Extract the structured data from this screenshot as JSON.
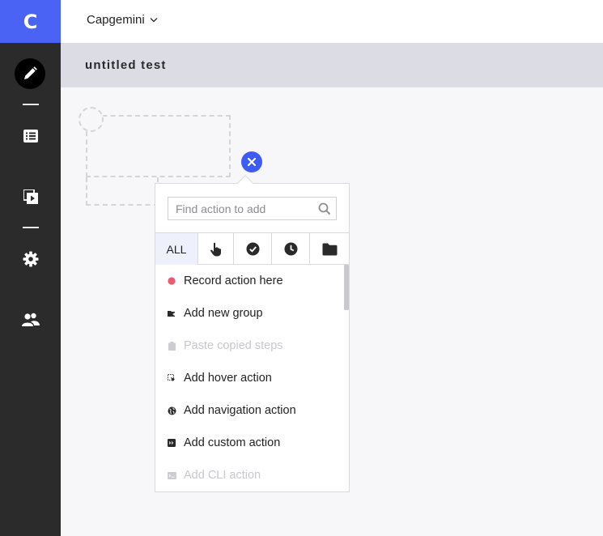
{
  "app": {
    "logo_letter": "C",
    "accent": "#4a63f5"
  },
  "sidebar": {
    "items": [
      {
        "name": "edit",
        "icon": "pencil-icon",
        "active": true
      },
      {
        "name": "tests",
        "icon": "list-icon"
      },
      {
        "name": "runs",
        "icon": "play-stack-icon"
      },
      {
        "name": "settings",
        "icon": "gear-icon"
      },
      {
        "name": "team",
        "icon": "users-icon"
      }
    ]
  },
  "topbar": {
    "workspace": "Capgemini"
  },
  "test": {
    "title": "untitled test"
  },
  "popup": {
    "search": {
      "placeholder": "Find action to add",
      "value": ""
    },
    "tabs": [
      {
        "label": "ALL",
        "active": true
      },
      {
        "icon": "pointer-hand-icon"
      },
      {
        "icon": "check-circle-icon"
      },
      {
        "icon": "clock-icon"
      },
      {
        "icon": "folder-icon"
      }
    ],
    "actions": [
      {
        "label": "Record action here",
        "icon": "record-dot-icon",
        "disabled": false
      },
      {
        "label": "Add new group",
        "icon": "group-icon",
        "disabled": false
      },
      {
        "label": "Paste copied steps",
        "icon": "clipboard-icon",
        "disabled": true
      },
      {
        "label": "Add hover action",
        "icon": "hover-cursor-icon",
        "disabled": false
      },
      {
        "label": "Add navigation action",
        "icon": "globe-icon",
        "disabled": false
      },
      {
        "label": "Add custom action",
        "icon": "code-icon",
        "disabled": false
      },
      {
        "label": "Add CLI action",
        "icon": "terminal-icon",
        "disabled": true
      }
    ]
  },
  "colors": {
    "record": "#ef5a73",
    "close": "#3d5cf5",
    "sidebar": "#2b2b2b"
  }
}
